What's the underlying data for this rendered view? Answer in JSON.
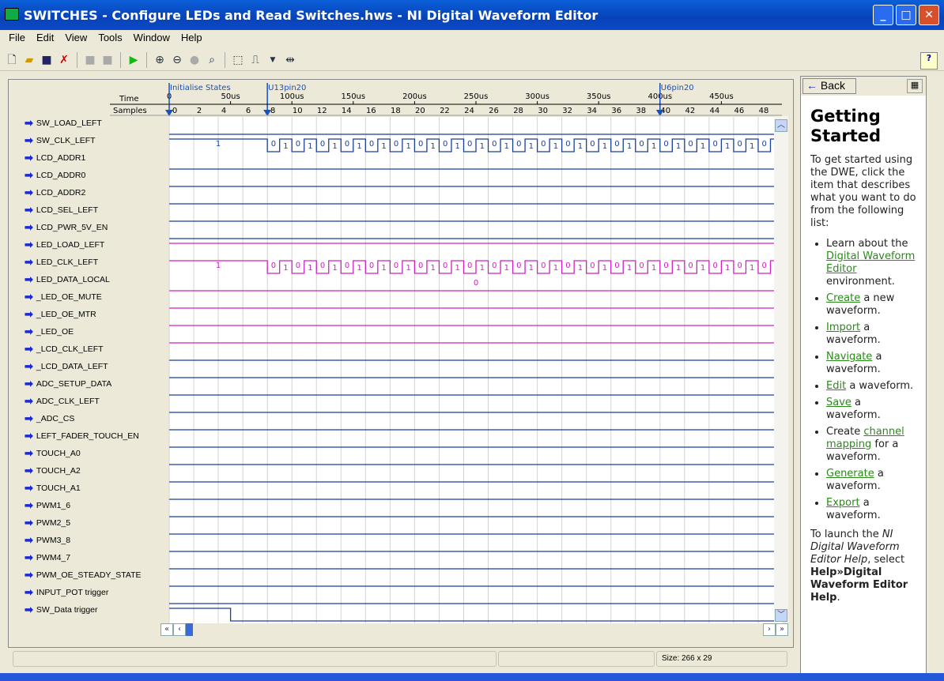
{
  "window": {
    "title": "SWITCHES - Configure LEDs and Read Switches.hws - NI Digital Waveform Editor"
  },
  "menu": [
    "File",
    "Edit",
    "View",
    "Tools",
    "Window",
    "Help"
  ],
  "toolbar": [
    "new-file-icon",
    "open-folder-icon",
    "save-icon",
    "close-file-icon",
    "copy-icon",
    "paste-icon",
    "run-icon",
    "zoom-in-icon",
    "zoom-out-icon",
    "zoom-fit-icon",
    "zoom-1to1-icon",
    "select-region-icon",
    "edge-icon",
    "dropdown-icon",
    "transition-icon"
  ],
  "ruler": {
    "time_label": "Time",
    "samples_label": "Samples",
    "time_ticks": [
      "0",
      "50us",
      "100us",
      "150us",
      "200us",
      "250us",
      "300us",
      "350us",
      "400us",
      "450us"
    ],
    "sample_ticks": [
      "0",
      "2",
      "4",
      "6",
      "8",
      "10",
      "12",
      "14",
      "16",
      "18",
      "20",
      "22",
      "24",
      "26",
      "28",
      "30",
      "32",
      "34",
      "36",
      "38",
      "40",
      "42",
      "44",
      "46",
      "48"
    ],
    "markers": [
      {
        "label": "Initialise States",
        "sample": 0
      },
      {
        "label": "U13pin20",
        "sample": 8
      },
      {
        "label": "U6pin20",
        "sample": 40
      }
    ]
  },
  "colors": {
    "blue": "#1a3f9a",
    "magenta": "#d020c0"
  },
  "signals": [
    {
      "name": "SW_LOAD_LEFT",
      "color": "blue",
      "samples": "0"
    },
    {
      "name": "SW_CLK_LEFT",
      "color": "blue",
      "samples": "11111111010101010101010101010101010101010101010101",
      "labels": true
    },
    {
      "name": "LCD_ADDR1",
      "color": "blue",
      "samples": "0"
    },
    {
      "name": "LCD_ADDR0",
      "color": "blue",
      "samples": "0"
    },
    {
      "name": "LCD_ADDR2",
      "color": "blue",
      "samples": "0"
    },
    {
      "name": "LCD_SEL_LEFT",
      "color": "blue",
      "samples": "0"
    },
    {
      "name": "LCD_PWR_5V_EN",
      "color": "blue",
      "samples": "0"
    },
    {
      "name": "LED_LOAD_LEFT",
      "color": "magenta",
      "samples": "1"
    },
    {
      "name": "LED_CLK_LEFT",
      "color": "magenta",
      "samples": "11111111010101010101010101010101010101010101010101",
      "labels": true
    },
    {
      "name": "LED_DATA_LOCAL",
      "color": "magenta",
      "samples": "0",
      "labels": true
    },
    {
      "name": "_LED_OE_MUTE",
      "color": "magenta",
      "samples": "0"
    },
    {
      "name": "_LED_OE_MTR",
      "color": "magenta",
      "samples": "0"
    },
    {
      "name": "_LED_OE",
      "color": "magenta",
      "samples": "0"
    },
    {
      "name": "_LCD_CLK_LEFT",
      "color": "blue",
      "samples": "0"
    },
    {
      "name": "_LCD_DATA_LEFT",
      "color": "blue",
      "samples": "0"
    },
    {
      "name": "ADC_SETUP_DATA",
      "color": "blue",
      "samples": "0"
    },
    {
      "name": "ADC_CLK_LEFT",
      "color": "blue",
      "samples": "0"
    },
    {
      "name": "_ADC_CS",
      "color": "blue",
      "samples": "0"
    },
    {
      "name": "LEFT_FADER_TOUCH_EN",
      "color": "blue",
      "samples": "0"
    },
    {
      "name": "TOUCH_A0",
      "color": "blue",
      "samples": "0"
    },
    {
      "name": "TOUCH_A2",
      "color": "blue",
      "samples": "0"
    },
    {
      "name": "TOUCH_A1",
      "color": "blue",
      "samples": "0"
    },
    {
      "name": "PWM1_6",
      "color": "blue",
      "samples": "0"
    },
    {
      "name": "PWM2_5",
      "color": "blue",
      "samples": "0"
    },
    {
      "name": "PWM3_8",
      "color": "blue",
      "samples": "0"
    },
    {
      "name": "PWM4_7",
      "color": "blue",
      "samples": "0"
    },
    {
      "name": "PWM_OE_STEADY_STATE",
      "color": "blue",
      "samples": "0"
    },
    {
      "name": "INPUT_POT trigger",
      "color": "blue",
      "samples": "0"
    },
    {
      "name": "SW_Data trigger",
      "color": "blue",
      "samples": "11111000000000000000000000000000000000000000000000"
    }
  ],
  "status": {
    "size": "Size: 266 x 29"
  },
  "help": {
    "back": "Back",
    "title": "Getting Started",
    "intro": "To get started using the DWE, click the item that describes what you want to do from the following list:",
    "items": [
      {
        "pre": "Learn about the ",
        "link": "Digital Waveform Editor",
        "post": " environment."
      },
      {
        "pre": "",
        "link": "Create",
        "post": " a new waveform."
      },
      {
        "pre": "",
        "link": "Import",
        "post": " a waveform."
      },
      {
        "pre": "",
        "link": "Navigate",
        "post": " a waveform."
      },
      {
        "pre": "",
        "link": "Edit",
        "post": " a waveform."
      },
      {
        "pre": "",
        "link": "Save",
        "post": " a waveform."
      },
      {
        "pre": "Create ",
        "link": "channel mapping",
        "post": " for a waveform."
      },
      {
        "pre": "",
        "link": "Generate",
        "post": " a waveform."
      },
      {
        "pre": "",
        "link": "Export",
        "post": " a waveform."
      }
    ],
    "outro_pre": "To launch the ",
    "outro_em": "NI Digital Waveform Editor Help",
    "outro_mid": ", select ",
    "outro_bold": "Help»Digital Waveform Editor Help",
    "outro_end": "."
  }
}
